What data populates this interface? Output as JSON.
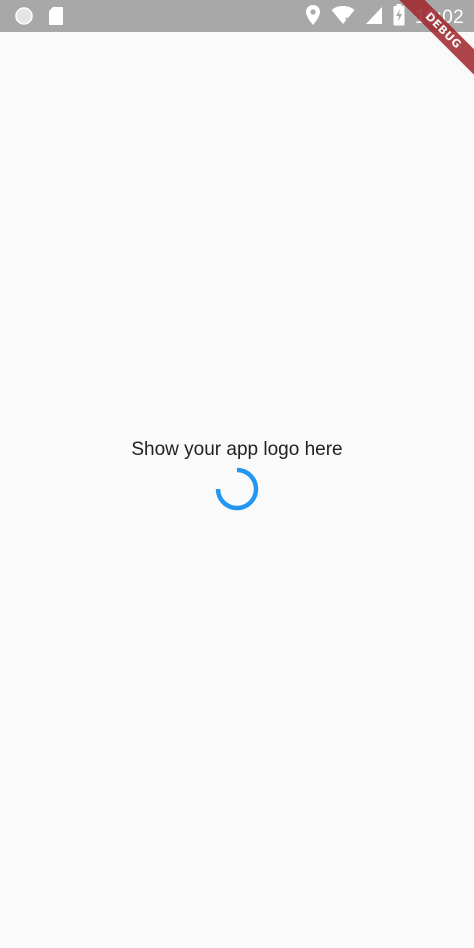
{
  "status_bar": {
    "time": "10:02",
    "left_icons": [
      "circle-notification-icon",
      "sd-card-icon"
    ],
    "right_icons": [
      "location-icon",
      "wifi-icon",
      "signal-icon",
      "battery-charging-icon"
    ],
    "background": "#a8a8a8"
  },
  "debug_banner": {
    "label": "DEBUG",
    "color": "#a0252b"
  },
  "main": {
    "logo_placeholder_text": "Show your app logo here",
    "spinner_color": "#2196f3"
  },
  "background": "#fafafa"
}
